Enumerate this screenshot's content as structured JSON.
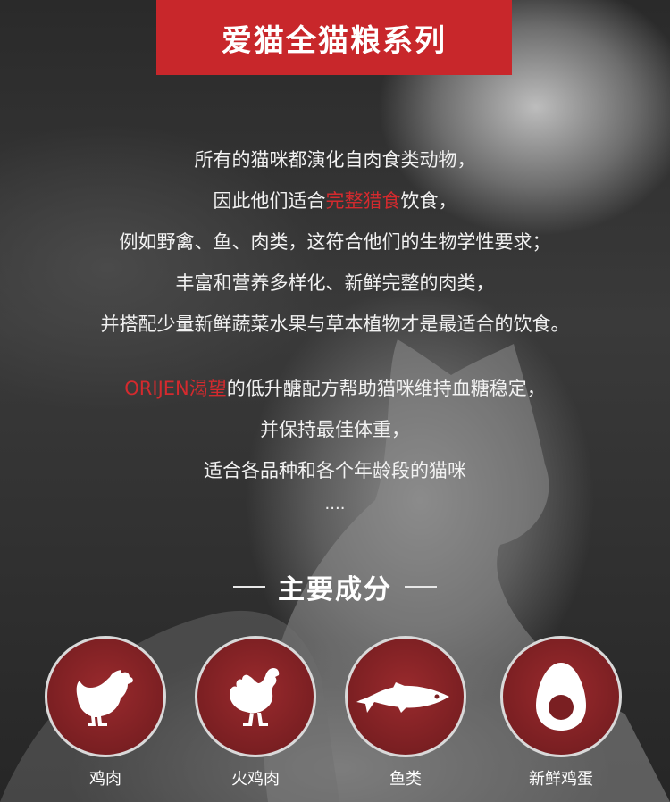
{
  "banner": {
    "title": "爱猫全猫粮系列"
  },
  "intro": {
    "lines": [
      {
        "text": "所有的猫咪都演化自肉食类动物，"
      },
      {
        "before": "因此他们适合",
        "highlight": "完整猎食",
        "after": "饮食，"
      },
      {
        "text": "例如野禽、鱼、肉类，这符合他们的生物学性要求；"
      },
      {
        "text": "丰富和营养多样化、新鲜完整的肉类，"
      },
      {
        "text": "并搭配少量新鲜蔬菜水果与草本植物才是最适合的饮食。"
      }
    ]
  },
  "para2": {
    "line1_highlight": "ORIJEN渴望",
    "line1_rest": "的低升醣配方帮助猫咪维持血糖稳定，",
    "line2": "并保持最佳体重，",
    "line3": "适合各品种和各个年龄段的猫咪",
    "ellipsis": "...."
  },
  "section": {
    "title": "主要成分"
  },
  "ingredients": [
    {
      "label": "鸡肉",
      "icon": "chicken-icon"
    },
    {
      "label": "火鸡肉",
      "icon": "turkey-icon"
    },
    {
      "label": "鱼类",
      "icon": "fish-icon"
    },
    {
      "label": "新鲜鸡蛋",
      "icon": "egg-icon"
    }
  ],
  "colors": {
    "accent_red": "#c8272b",
    "highlight_red": "#d42a2e",
    "circle_red": "#7a1f22"
  }
}
